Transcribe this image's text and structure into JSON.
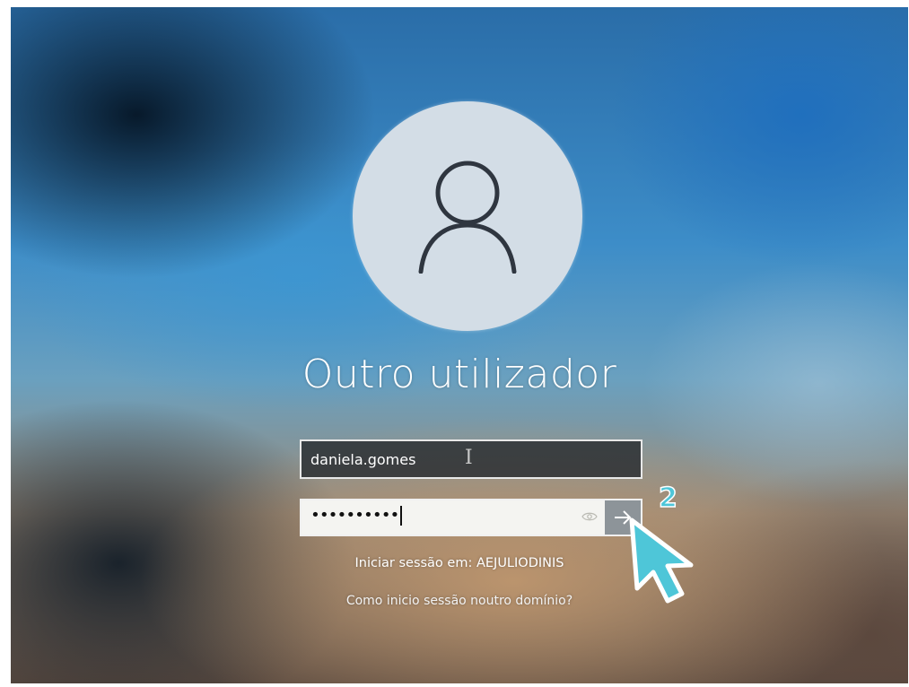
{
  "login": {
    "user_name_title": "Outro utilizador",
    "username_value": "daniela.gomes",
    "password_masked": "••••••••••",
    "signin_target": "Iniciar sessão em: AEJULIODINIS",
    "other_domain_link": "Como inicio sessão noutro domínio?"
  },
  "annotation": {
    "step_number": "2",
    "arrow_color": "#4ec6d8"
  },
  "icons": {
    "avatar": "user-silhouette-icon",
    "reveal": "eye-icon",
    "submit": "arrow-right-icon",
    "text_cursor": "ibeam-cursor-icon",
    "pointer": "mouse-pointer-icon"
  }
}
